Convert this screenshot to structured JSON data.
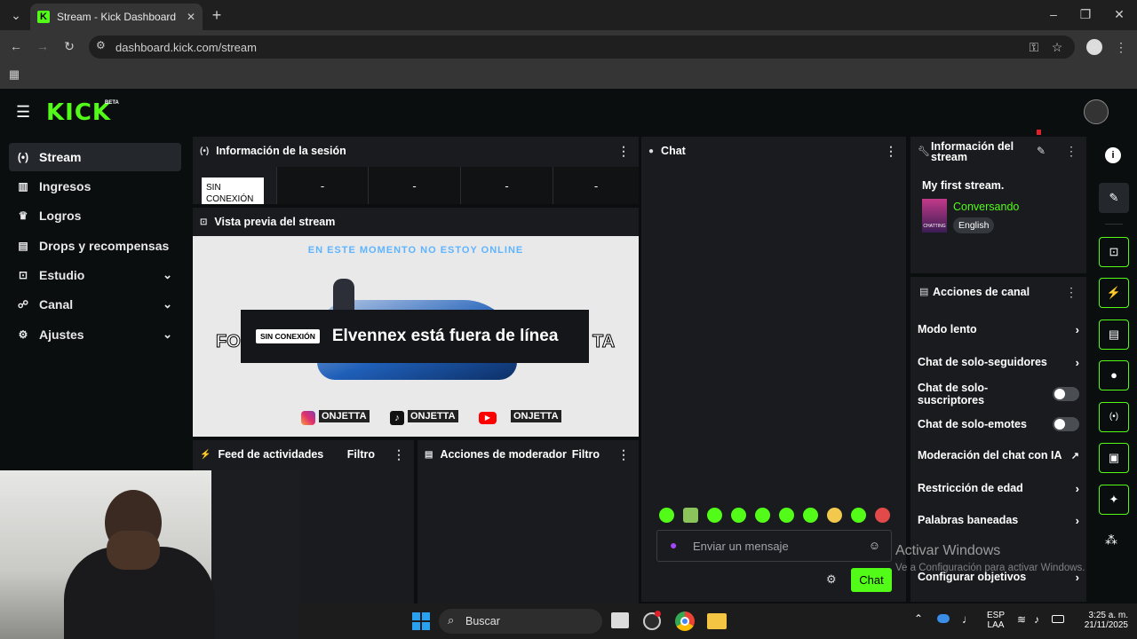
{
  "browser": {
    "tab_title": "Stream - Kick Dashboard",
    "url": "dashboard.kick.com/stream"
  },
  "header": {
    "logo": "KICK",
    "beta": "BETA"
  },
  "sidebar": {
    "items": [
      {
        "label": "Stream",
        "icon": "broadcast-icon"
      },
      {
        "label": "Ingresos",
        "icon": "chart-icon"
      },
      {
        "label": "Logros",
        "icon": "trophy-icon"
      },
      {
        "label": "Drops y recompensas",
        "icon": "gift-icon"
      },
      {
        "label": "Estudio",
        "icon": "studio-icon"
      },
      {
        "label": "Canal",
        "icon": "users-icon"
      },
      {
        "label": "Ajustes",
        "icon": "gear-icon"
      }
    ]
  },
  "session": {
    "title": "Información de la sesión",
    "status": "SIN CONEXIÓN",
    "metrics": [
      "-",
      "-",
      "-",
      "-"
    ]
  },
  "preview": {
    "title": "Vista previa del stream",
    "banner_top": "EN ESTE MOMENTO NO ESTOY ONLINE",
    "badge": "SIN CONEXIÓN",
    "offline_text": "Elvennex está fuera de línea",
    "side_left": "FO",
    "side_right": "TA",
    "socials": [
      "ONJETTA",
      "ONJETTA",
      "ONJETTA"
    ]
  },
  "feed": {
    "title": "Feed de actividades",
    "filter": "Filtro"
  },
  "mod": {
    "title": "Acciones de moderador",
    "filter": "Filtro"
  },
  "chat": {
    "title": "Chat",
    "placeholder": "Enviar un mensaje",
    "send": "Chat"
  },
  "stream_info": {
    "title_line1": "Información del",
    "title_line2": "stream",
    "stream_title": "My first stream.",
    "category": "Conversando",
    "thumb_label": "CHATTING",
    "language": "English"
  },
  "channel_actions": {
    "title": "Acciones de canal",
    "items": [
      {
        "label": "Modo lento",
        "control": "chevron"
      },
      {
        "label": "Chat de solo-seguidores",
        "control": "chevron"
      },
      {
        "label": "Chat de solo-suscriptores",
        "control": "toggle"
      },
      {
        "label": "Chat de solo-emotes",
        "control": "toggle"
      },
      {
        "label": "Moderación del chat con IA",
        "control": "external"
      },
      {
        "label": "Restricción de edad",
        "control": "chevron"
      },
      {
        "label": "Palabras baneadas",
        "control": "chevron"
      },
      {
        "label": "Configurar objetivos",
        "control": "chevron"
      }
    ]
  },
  "watermark": {
    "line1": "Activar Windows",
    "line2": "Ve a Configuración para activar Windows."
  },
  "taskbar": {
    "search": "Buscar",
    "lang1": "ESP",
    "lang2": "LAA",
    "time": "3:25 a. m.",
    "date": "21/11/2025"
  },
  "colors": {
    "accent": "#53fc18",
    "panel": "#191b1f",
    "bg": "#0b0e0f"
  }
}
